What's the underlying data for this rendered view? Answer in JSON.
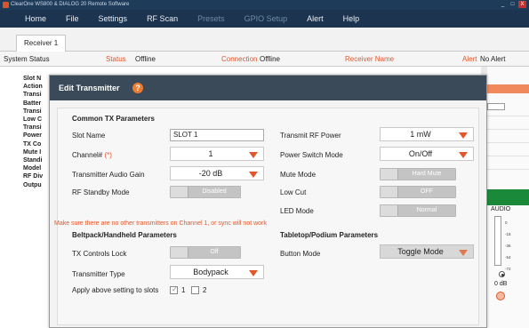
{
  "window": {
    "title": "ClearOne WS800 & DIALOG 20 Remote Software",
    "controls": [
      "_",
      "□",
      "X"
    ]
  },
  "menu": [
    "Home",
    "File",
    "Settings",
    "RF Scan",
    "Presets",
    "GPIO Setup",
    "Alert",
    "Help"
  ],
  "tabs": [
    "Receiver 1"
  ],
  "status": {
    "system_status_label": "System Status",
    "status_label": "Status",
    "status_value": "Offline",
    "connection_label": "Connection",
    "connection_value": "Offline",
    "receiver_name_label": "Receiver Name",
    "alert_label": "Alert",
    "alert_value": "No Alert"
  },
  "left_list": [
    "Slot N",
    "Action",
    "Transi",
    "Batter",
    "Transi",
    "Low C",
    "Transi",
    "Power",
    "TX Co",
    "Mute I",
    "Standi",
    "Model",
    "RF Div",
    "Outpu"
  ],
  "right_panel": {
    "audio_label": "AUDIO",
    "meter_ticks": [
      "0",
      "-18",
      "-36",
      "-54",
      "-72"
    ],
    "db_value": "0 dB"
  },
  "dialog": {
    "title": "Edit Transmitter",
    "help_icon": "?",
    "close": "×",
    "common_header": "Common TX Parameters",
    "slot_name_label": "Slot Name",
    "slot_name_value": "SLOT 1",
    "channel_label": "Channel#",
    "channel_req": "(*)",
    "channel_value": "1",
    "audio_gain_label": "Transmitter Audio Gain",
    "audio_gain_value": "-20 dB",
    "rf_standby_label": "RF Standby Mode",
    "rf_standby_value": "Disabled",
    "rf_power_label": "Transmit RF Power",
    "rf_power_value": "1 mW",
    "power_switch_label": "Power Switch Mode",
    "power_switch_value": "On/Off",
    "mute_mode_label": "Mute Mode",
    "mute_mode_value": "Hard Mute",
    "low_cut_label": "Low Cut",
    "low_cut_value": "OFF",
    "led_mode_label": "LED Mode",
    "led_mode_value": "Normal",
    "warning": "Make sure there are no other transmitters on Channel 1, or sync will not work",
    "beltpack_header": "Beltpack/Handheld Parameters",
    "tx_lock_label": "TX Controls Lock",
    "tx_lock_value": "Off",
    "tx_type_label": "Transmitter Type",
    "tx_type_value": "Bodypack",
    "tabletop_header": "Tabletop/Podium Parameters",
    "button_mode_label": "Button Mode",
    "button_mode_value": "Toggle Mode",
    "apply_label": "Apply above setting to slots",
    "slot_1": "1",
    "slot_2": "2"
  },
  "colors": {
    "accent": "#e2562a",
    "menubar": "#1c3450",
    "dialog_header": "#3a4a58",
    "green": "#1a8a3a"
  }
}
